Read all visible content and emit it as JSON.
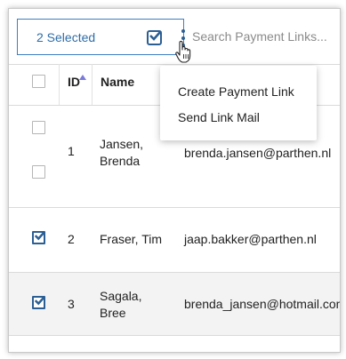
{
  "toolbar": {
    "selected_label": "2 Selected",
    "search_placeholder": "Search Payment Links..."
  },
  "table": {
    "columns": {
      "id": "ID",
      "name": "Name"
    },
    "rows": [
      {
        "id": "1",
        "name_line1": "Jansen,",
        "name_line2": "Brenda",
        "email": "brenda.jansen@parthen.nl",
        "checked": false
      },
      {
        "id": "2",
        "name_line1": "Fraser, Tim",
        "name_line2": "",
        "email": "jaap.bakker@parthen.nl",
        "checked": true
      },
      {
        "id": "3",
        "name_line1": "Sagala,",
        "name_line2": "Bree",
        "email": "brenda_jansen@hotmail.com",
        "checked": true
      }
    ]
  },
  "menu": {
    "items": [
      "Create Payment Link",
      "Send Link Mail"
    ]
  },
  "icons": {
    "select_all": "checkbox-checked-icon",
    "more": "kebab-menu-icon",
    "cursor": "hand-pointer-cursor-icon",
    "sort": "sort-ascending-icon"
  },
  "colors": {
    "accent": "#2b5f94",
    "selection_border": "#3b7fc4",
    "row_highlight": "#f3f3f3"
  }
}
